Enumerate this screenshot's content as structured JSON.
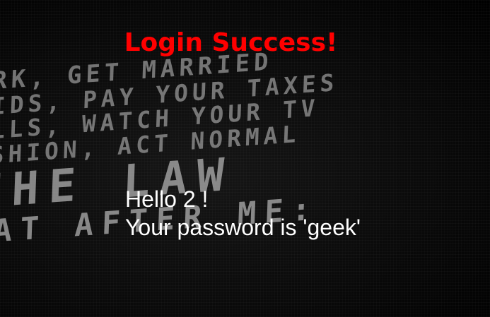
{
  "page": {
    "title": "Login Success!",
    "greeting_line": "Hello 2 !",
    "password_line": "Your password is 'geek'"
  },
  "background": {
    "lines": [
      "RK, GET MARRIED",
      "IDS, PAY YOUR TAXES",
      "LLS, WATCH YOUR TV",
      "SHION, ACT NORMAL",
      "THE LAW",
      "EAT AFTER ME:"
    ]
  },
  "colors": {
    "title": "#ff0000",
    "text": "#ffffff",
    "background": "#000000"
  }
}
